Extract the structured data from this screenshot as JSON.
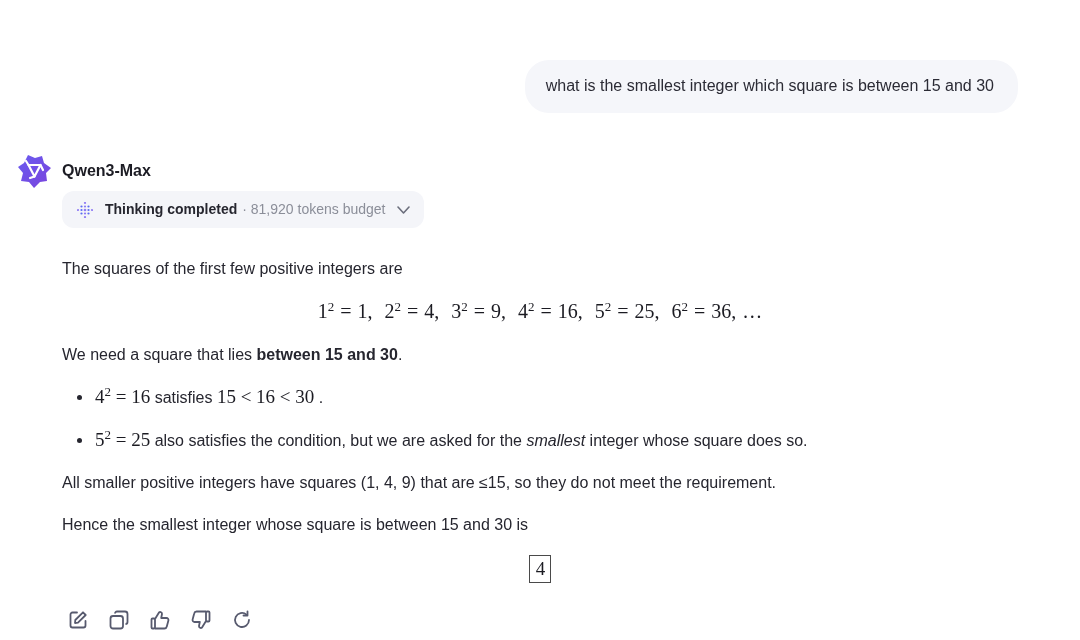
{
  "user_message": {
    "text": "what is the smallest integer which square is between 15 and 30"
  },
  "response": {
    "model_name": "Qwen3-Max",
    "thinking": {
      "label": "Thinking completed",
      "detail": "· 81,920 tokens budget",
      "expanded": false
    },
    "blocks": [
      {
        "kind": "paragraph",
        "text": "The squares of the first few positive integers are"
      },
      {
        "kind": "display_math",
        "text": "1$^{2}$ = 1,  2$^{2}$ = 4,  3$^{2}$ = 9,  4$^{2}$ = 16,  5$^{2}$ = 25,  6$^{2}$ = 36, …"
      },
      {
        "kind": "paragraph",
        "text": "We need a square that lies **between 15 and 30**."
      },
      {
        "kind": "bullets",
        "items": [
          {
            "parts": [
              {
                "kind": "math",
                "text": "4$^{2}$ = 16"
              },
              {
                "kind": "text",
                "text": " satisfies "
              },
              {
                "kind": "math",
                "text": "15 < 16 < 30"
              },
              {
                "kind": "text",
                "text": " ."
              }
            ]
          },
          {
            "parts": [
              {
                "kind": "math",
                "text": "5$^{2}$ = 25"
              },
              {
                "kind": "text",
                "text": " also satisfies the condition, but we are asked for the *smallest* integer whose square does so."
              }
            ]
          }
        ]
      },
      {
        "kind": "paragraph",
        "text": "All smaller positive integers have squares (1, 4, 9) that are ≤15, so they do not meet the requirement."
      },
      {
        "kind": "paragraph",
        "text": "Hence the smallest integer whose square is between 15 and 30 is"
      },
      {
        "kind": "boxed_math",
        "text": "4"
      }
    ]
  }
}
